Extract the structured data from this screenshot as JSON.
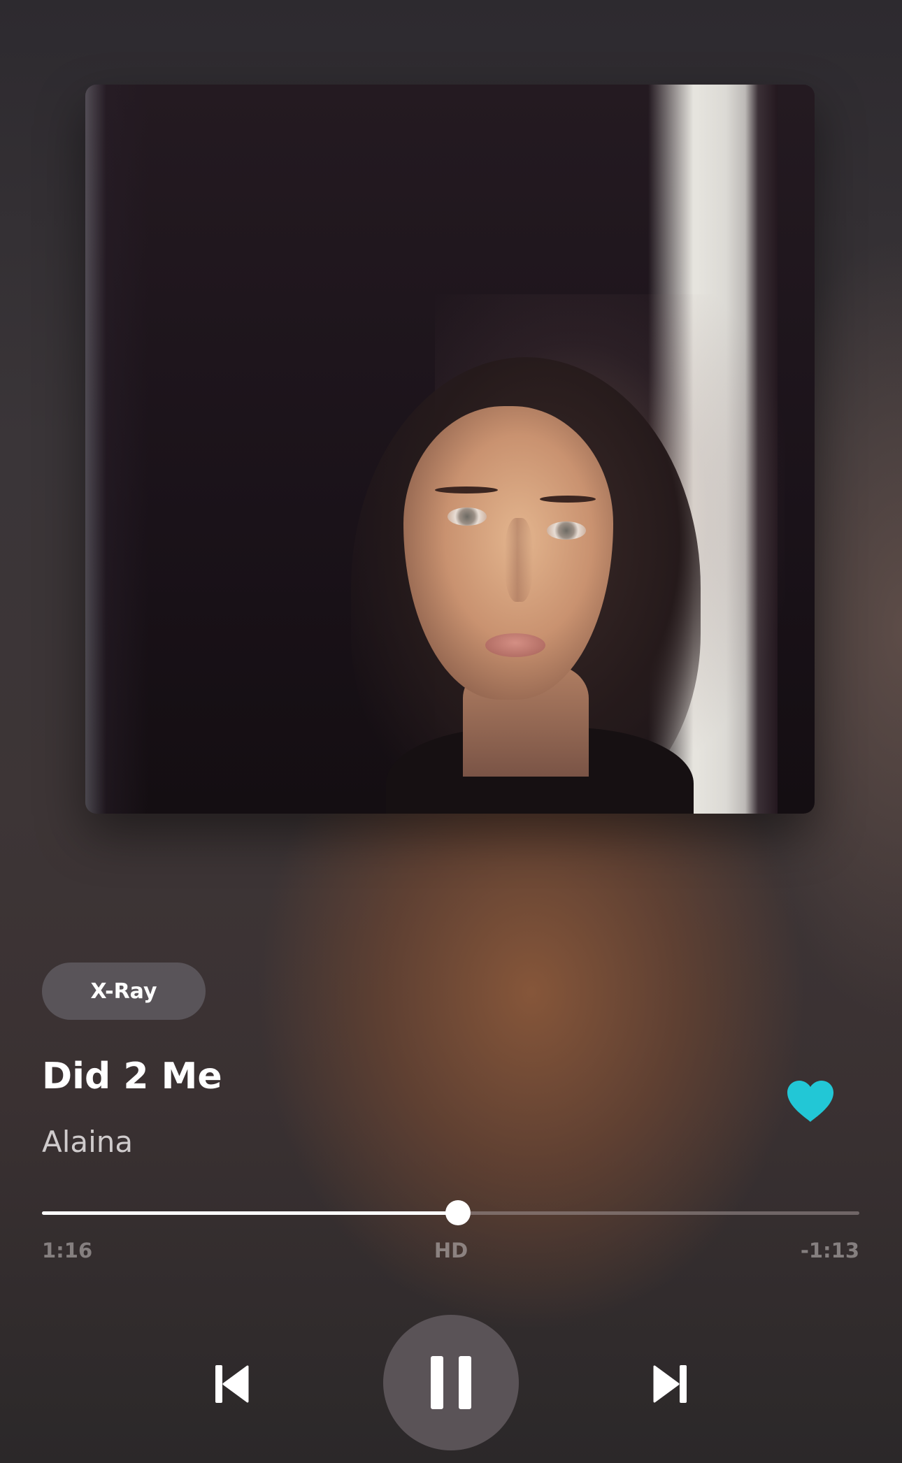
{
  "album_art": {
    "icon": "album-cover-image"
  },
  "xray": {
    "label": "X-Ray"
  },
  "track": {
    "title": "Did 2 Me",
    "artist": "Alaina",
    "liked": true
  },
  "playback": {
    "elapsed": "1:16",
    "remaining": "-1:13",
    "quality": "HD",
    "progress": 0.509,
    "state": "playing"
  },
  "controls": {
    "previous_icon": "skip-previous-icon",
    "pause_icon": "pause-icon",
    "next_icon": "skip-next-icon"
  },
  "colors": {
    "accent": "#22c7d6",
    "progress_fill": "#ffffff"
  }
}
